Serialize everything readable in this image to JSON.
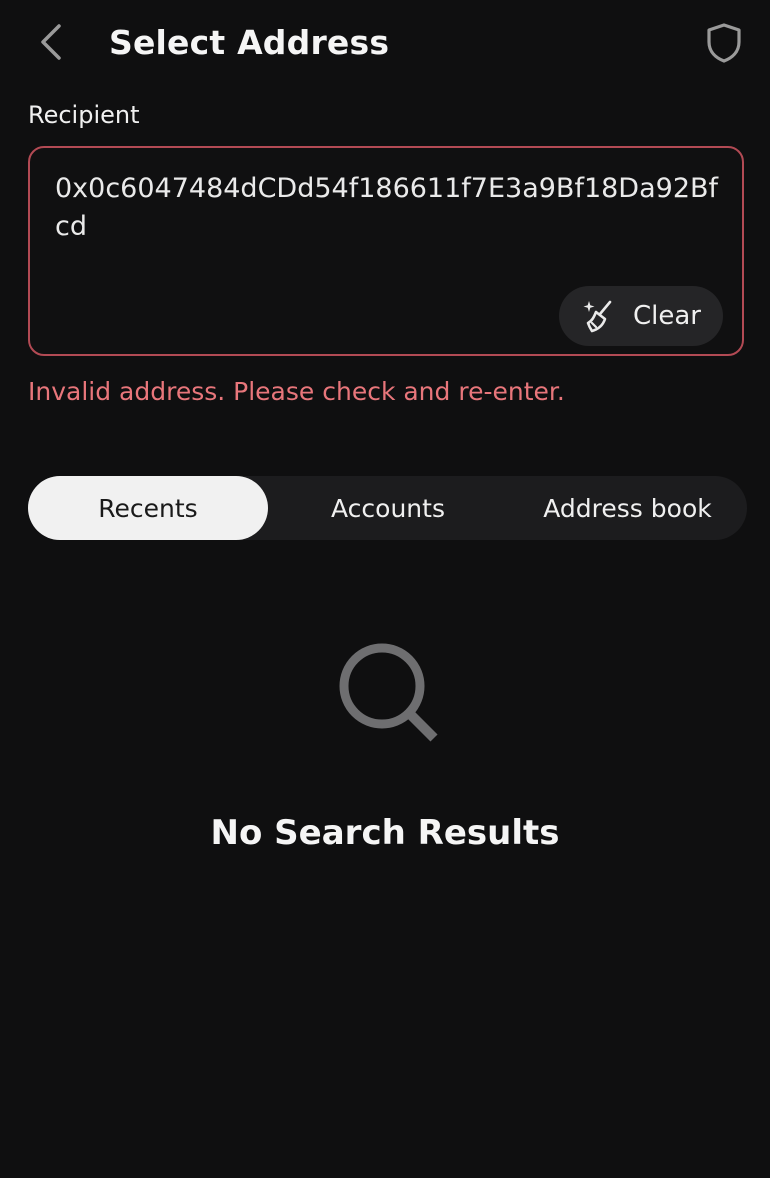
{
  "header": {
    "title": "Select Address",
    "back_icon": "chevron-left-icon",
    "shield_icon": "shield-icon"
  },
  "recipient": {
    "label": "Recipient",
    "value": "0x0c6047484dCDd54f186611f7E3a9Bf18Da92Bfcd",
    "clear_label": "Clear",
    "clear_icon": "broom-sparkle-icon",
    "error": "Invalid address. Please check and re-enter."
  },
  "tabs": [
    {
      "label": "Recents",
      "active": true
    },
    {
      "label": "Accounts",
      "active": false
    },
    {
      "label": "Address book",
      "active": false
    }
  ],
  "empty_state": {
    "icon": "search-icon",
    "text": "No Search Results"
  },
  "colors": {
    "background": "#0f0f10",
    "error": "#e8767b",
    "input_border": "#b24a54",
    "tab_bar": "#1c1c1e",
    "tab_active": "#f1f1f1",
    "clear_button": "#252527"
  }
}
